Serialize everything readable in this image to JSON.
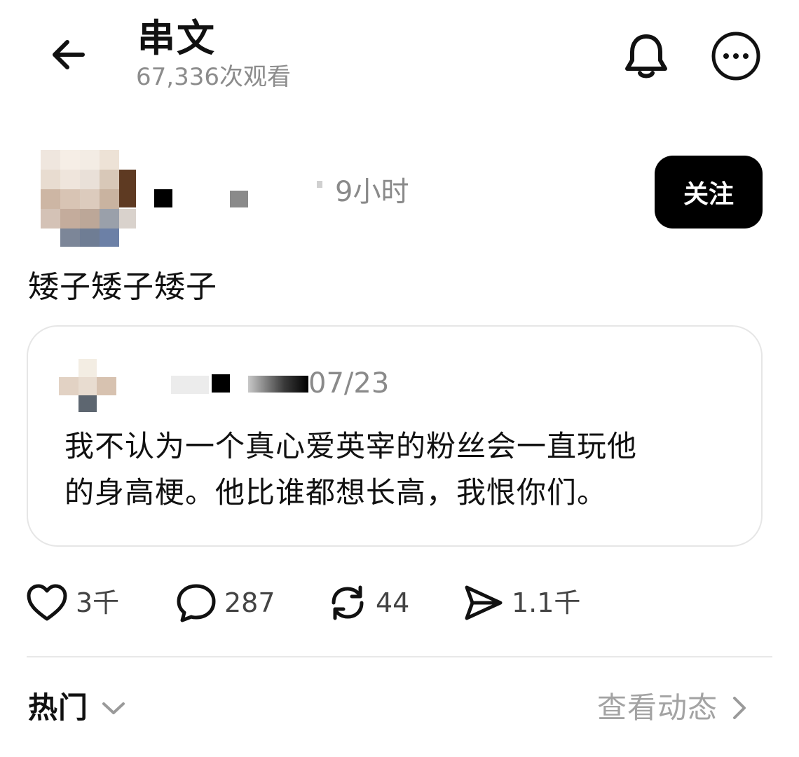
{
  "header": {
    "title": "串文",
    "views": "67,336次观看"
  },
  "post": {
    "author_name_hidden": true,
    "time": "9小时",
    "follow_label": "关注",
    "text": "矮子矮子矮子",
    "quote": {
      "date": "07/23",
      "text_line1": "我不认为一个真心爱英宰的粉丝会一直玩他",
      "text_line2": "的身高梗。他比谁都想长高，我恨你们。"
    },
    "actions": {
      "likes": "3千",
      "replies": "287",
      "reposts": "44",
      "shares": "1.1千"
    }
  },
  "footer": {
    "sort_label": "热门",
    "activity_label": "查看动态"
  },
  "icons": {
    "back": "back-arrow-icon",
    "bell": "bell-icon",
    "more": "more-icon",
    "like": "heart-icon",
    "reply": "comment-icon",
    "repost": "repost-icon",
    "share": "send-icon",
    "sort": "chevron-down-icon",
    "activity": "chevron-right-icon"
  },
  "colors": {
    "text": "#111111",
    "muted": "#8a8a8a",
    "follow_bg": "#000000",
    "border": "#e6e6e6"
  }
}
